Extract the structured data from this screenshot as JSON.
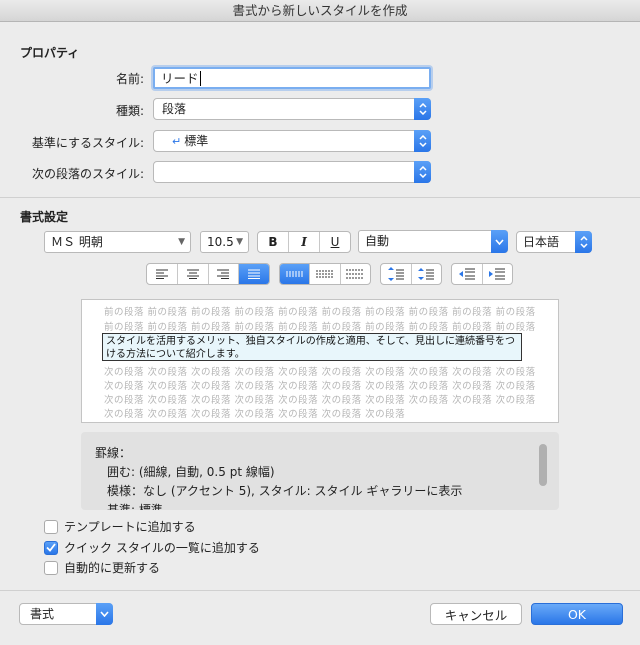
{
  "window": {
    "title": "書式から新しいスタイルを作成"
  },
  "properties": {
    "section_title": "プロパティ",
    "name_label": "名前:",
    "name_value": "リード",
    "type_label": "種類:",
    "type_value": "段落",
    "based_on_label": "基準にするスタイル:",
    "based_on_value": "標準",
    "next_label": "次の段落のスタイル:",
    "next_value": ""
  },
  "formatting": {
    "section_title": "書式設定",
    "font": "ＭＳ 明朝",
    "size": "10.5",
    "bold": "B",
    "italic": "I",
    "underline": "U",
    "color": "自動",
    "language": "日本語"
  },
  "preview": {
    "prev_lines": [
      "前の段落 前の段落 前の段落 前の段落 前の段落 前の段落 前の段落 前の段落 前の段落 前の段落",
      "前の段落 前の段落 前の段落 前の段落 前の段落 前の段落 前の段落 前の段落 前の段落 前の段落"
    ],
    "current_text": "スタイルを活用するメリット、独自スタイルの作成と適用、そして、見出しに連続番号をつける方法について紹介します。",
    "next_lines": [
      "次の段落 次の段落 次の段落 次の段落 次の段落 次の段落 次の段落 次の段落 次の段落 次の段落",
      "次の段落 次の段落 次の段落 次の段落 次の段落 次の段落 次の段落 次の段落 次の段落 次の段落",
      "次の段落 次の段落 次の段落 次の段落 次の段落 次の段落 次の段落 次の段落 次の段落 次の段落",
      "次の段落 次の段落 次の段落 次の段落 次の段落 次の段落 次の段落"
    ]
  },
  "description": {
    "line1": "罫線：",
    "line2": "囲む: (細線, 自動,  0.5 pt 線幅)",
    "line3": "模様：なし (アクセント 5), スタイル: スタイル ギャラリーに表示",
    "line4": "基準: 標準"
  },
  "options": {
    "add_to_template": "テンプレートに追加する",
    "add_to_quick_styles": "クイック スタイルの一覧に追加する",
    "auto_update": "自動的に更新する"
  },
  "footer": {
    "format_button": "書式",
    "cancel_button": "キャンセル",
    "ok_button": "OK"
  },
  "colors": {
    "accent": "#2a76e8",
    "focus": "#7aaef0"
  }
}
